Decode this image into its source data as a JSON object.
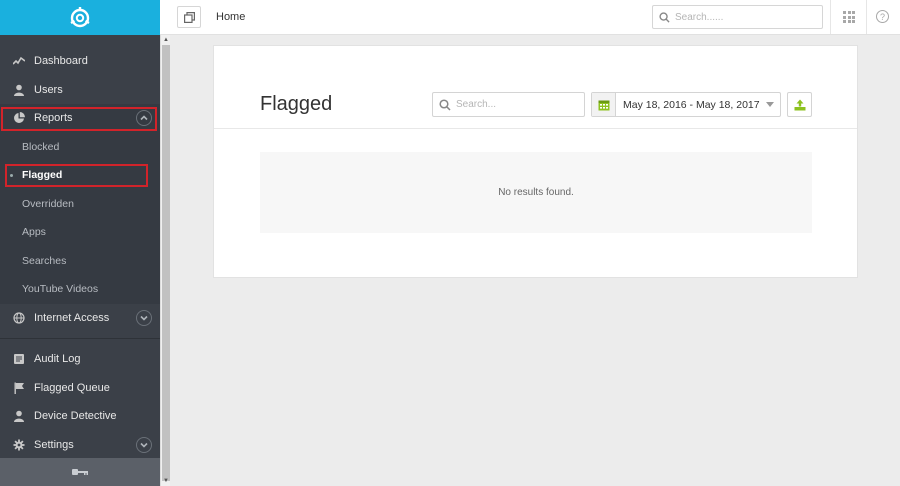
{
  "sidebar": {
    "items": [
      {
        "label": "Dashboard",
        "icon": "dashboard-icon"
      },
      {
        "label": "Users",
        "icon": "user-icon"
      },
      {
        "label": "Reports",
        "icon": "pie-chart-icon"
      }
    ],
    "report_sub_items": [
      {
        "label": "Blocked"
      },
      {
        "label": "Flagged"
      },
      {
        "label": "Overridden"
      },
      {
        "label": "Apps"
      },
      {
        "label": "Searches"
      },
      {
        "label": "YouTube Videos"
      }
    ],
    "internet_access": {
      "label": "Internet Access",
      "icon": "globe-icon"
    },
    "lower_items": [
      {
        "label": "Audit Log",
        "icon": "log-icon"
      },
      {
        "label": "Flagged Queue",
        "icon": "flag-icon"
      },
      {
        "label": "Device Detective",
        "icon": "user-icon"
      },
      {
        "label": "Settings",
        "icon": "gear-icon"
      }
    ]
  },
  "topbar": {
    "breadcrumb": "Home",
    "search_placeholder": "Search......"
  },
  "card": {
    "title": "Flagged",
    "search_placeholder": "Search...",
    "date_range": "May 18, 2016 - May 18, 2017",
    "empty_message": "No results found."
  },
  "colors": {
    "brand": "#1ab0de",
    "sidebar_bg": "#3b4048",
    "highlight_box": "#d2232a",
    "calendar_green": "#8dc21f"
  }
}
